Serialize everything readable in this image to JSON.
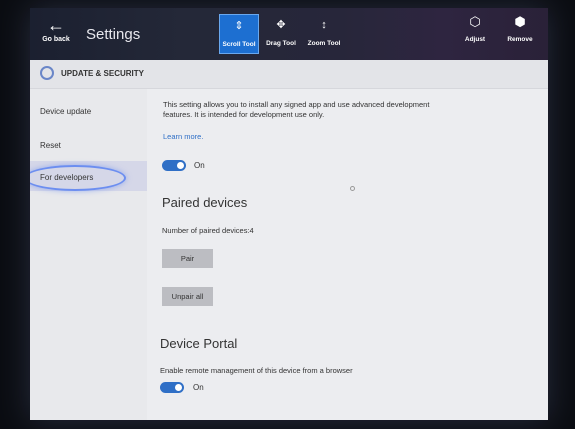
{
  "topbar": {
    "back_label": "Go back",
    "title": "Settings",
    "tools": [
      {
        "label": "Scroll Tool",
        "icon": "scroll-tool-icon"
      },
      {
        "label": "Drag Tool",
        "icon": "drag-tool-icon"
      },
      {
        "label": "Zoom Tool",
        "icon": "zoom-tool-icon"
      }
    ],
    "right_tools": [
      {
        "label": "Adjust",
        "icon": "adjust-icon"
      },
      {
        "label": "Remove",
        "icon": "remove-icon"
      }
    ],
    "active_tool_color": "#1d6fd1"
  },
  "section": {
    "title": "UPDATE & SECURITY"
  },
  "sidebar": {
    "items": [
      {
        "label": "Device update"
      },
      {
        "label": "Reset"
      },
      {
        "label": "For developers"
      }
    ],
    "selected": "For developers"
  },
  "main": {
    "description": "This setting allows you to install any signed app and use advanced development features. It is intended for development use only.",
    "learn_more": "Learn more.",
    "dev_toggle": "On",
    "paired": {
      "title": "Paired devices",
      "count_text": "Number of paired devices:4",
      "pair_button": "Pair",
      "unpair_button": "Unpair all"
    },
    "portal": {
      "title": "Device Portal",
      "description": "Enable remote management of this device from a browser",
      "toggle": "On"
    },
    "accent_color": "#2f6fc6"
  }
}
